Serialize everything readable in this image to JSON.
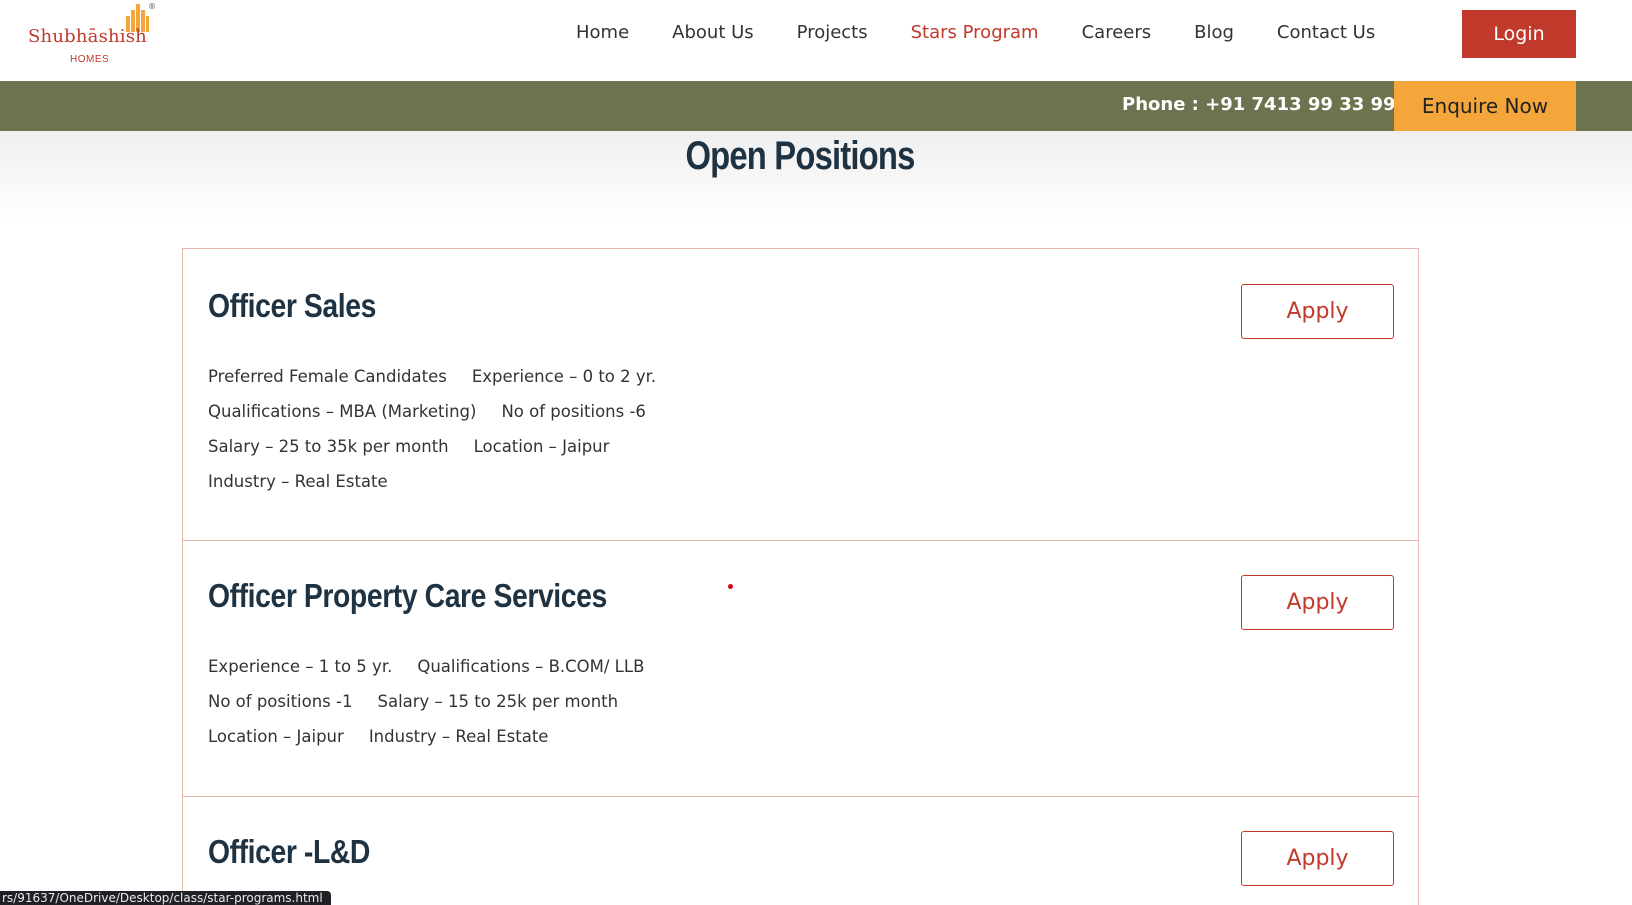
{
  "brand": {
    "name": "Shubhāshish",
    "sub": "HOMES",
    "reg": "®",
    "accent": "#c0392b"
  },
  "nav": [
    {
      "label": "Home",
      "active": false
    },
    {
      "label": "About Us",
      "active": false
    },
    {
      "label": "Projects",
      "active": false
    },
    {
      "label": "Stars Program",
      "active": true
    },
    {
      "label": "Careers",
      "active": false
    },
    {
      "label": "Blog",
      "active": false
    },
    {
      "label": "Contact Us",
      "active": false
    }
  ],
  "login_label": "Login",
  "bar": {
    "phone": "Phone : +91 7413 99 33 99",
    "enquire_label": "Enquire Now",
    "bar_color": "#6b744e",
    "enquire_color": "#f4a63a"
  },
  "page_title": "Open Positions",
  "positions": [
    {
      "title": "Officer Sales",
      "apply_label": "Apply",
      "rows": [
        [
          "Preferred Female Candidates",
          "Experience – 0 to 2 yr."
        ],
        [
          "Qualifications – MBA (Marketing)",
          "No of positions -6"
        ],
        [
          "Salary – 25 to 35k per month",
          "Location – Jaipur"
        ],
        [
          "Industry – Real Estate"
        ]
      ]
    },
    {
      "title": "Officer Property Care Services",
      "apply_label": "Apply",
      "rows": [
        [
          "Experience – 1 to 5 yr.",
          "Qualifications – B.COM/ LLB"
        ],
        [
          "No of positions -1",
          "Salary – 15 to 25k per month"
        ],
        [
          "Location – Jaipur",
          "Industry – Real Estate"
        ]
      ]
    },
    {
      "title": "Officer -L&D",
      "apply_label": "Apply",
      "rows": []
    }
  ],
  "status_url": "rs/91637/OneDrive/Desktop/class/star-programs.html"
}
